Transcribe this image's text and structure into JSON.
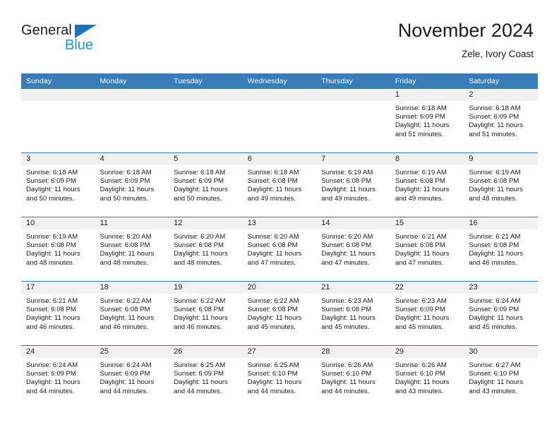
{
  "brand": {
    "name_top": "General",
    "name_bottom": "Blue",
    "triangle_color": "#1c75bc",
    "blue_color": "#1c9ad6"
  },
  "header": {
    "title": "November 2024",
    "location": "Zele, Ivory Coast"
  },
  "calendar": {
    "header_bg": "#3a7cb9",
    "daynum_bg": "#f1f1f1",
    "weekdays": [
      "Sunday",
      "Monday",
      "Tuesday",
      "Wednesday",
      "Thursday",
      "Friday",
      "Saturday"
    ],
    "weeks": [
      [
        {
          "day": "",
          "sunrise": "",
          "sunset": "",
          "daylight_line1": "",
          "daylight_line2": ""
        },
        {
          "day": "",
          "sunrise": "",
          "sunset": "",
          "daylight_line1": "",
          "daylight_line2": ""
        },
        {
          "day": "",
          "sunrise": "",
          "sunset": "",
          "daylight_line1": "",
          "daylight_line2": ""
        },
        {
          "day": "",
          "sunrise": "",
          "sunset": "",
          "daylight_line1": "",
          "daylight_line2": ""
        },
        {
          "day": "",
          "sunrise": "",
          "sunset": "",
          "daylight_line1": "",
          "daylight_line2": ""
        },
        {
          "day": "1",
          "sunrise": "Sunrise: 6:18 AM",
          "sunset": "Sunset: 6:09 PM",
          "daylight_line1": "Daylight: 11 hours",
          "daylight_line2": "and 51 minutes."
        },
        {
          "day": "2",
          "sunrise": "Sunrise: 6:18 AM",
          "sunset": "Sunset: 6:09 PM",
          "daylight_line1": "Daylight: 11 hours",
          "daylight_line2": "and 51 minutes."
        }
      ],
      [
        {
          "day": "3",
          "sunrise": "Sunrise: 6:18 AM",
          "sunset": "Sunset: 6:09 PM",
          "daylight_line1": "Daylight: 11 hours",
          "daylight_line2": "and 50 minutes."
        },
        {
          "day": "4",
          "sunrise": "Sunrise: 6:18 AM",
          "sunset": "Sunset: 6:09 PM",
          "daylight_line1": "Daylight: 11 hours",
          "daylight_line2": "and 50 minutes."
        },
        {
          "day": "5",
          "sunrise": "Sunrise: 6:18 AM",
          "sunset": "Sunset: 6:09 PM",
          "daylight_line1": "Daylight: 11 hours",
          "daylight_line2": "and 50 minutes."
        },
        {
          "day": "6",
          "sunrise": "Sunrise: 6:18 AM",
          "sunset": "Sunset: 6:08 PM",
          "daylight_line1": "Daylight: 11 hours",
          "daylight_line2": "and 49 minutes."
        },
        {
          "day": "7",
          "sunrise": "Sunrise: 6:19 AM",
          "sunset": "Sunset: 6:08 PM",
          "daylight_line1": "Daylight: 11 hours",
          "daylight_line2": "and 49 minutes."
        },
        {
          "day": "8",
          "sunrise": "Sunrise: 6:19 AM",
          "sunset": "Sunset: 6:08 PM",
          "daylight_line1": "Daylight: 11 hours",
          "daylight_line2": "and 49 minutes."
        },
        {
          "day": "9",
          "sunrise": "Sunrise: 6:19 AM",
          "sunset": "Sunset: 6:08 PM",
          "daylight_line1": "Daylight: 11 hours",
          "daylight_line2": "and 48 minutes."
        }
      ],
      [
        {
          "day": "10",
          "sunrise": "Sunrise: 6:19 AM",
          "sunset": "Sunset: 6:08 PM",
          "daylight_line1": "Daylight: 11 hours",
          "daylight_line2": "and 48 minutes."
        },
        {
          "day": "11",
          "sunrise": "Sunrise: 6:20 AM",
          "sunset": "Sunset: 6:08 PM",
          "daylight_line1": "Daylight: 11 hours",
          "daylight_line2": "and 48 minutes."
        },
        {
          "day": "12",
          "sunrise": "Sunrise: 6:20 AM",
          "sunset": "Sunset: 6:08 PM",
          "daylight_line1": "Daylight: 11 hours",
          "daylight_line2": "and 48 minutes."
        },
        {
          "day": "13",
          "sunrise": "Sunrise: 6:20 AM",
          "sunset": "Sunset: 6:08 PM",
          "daylight_line1": "Daylight: 11 hours",
          "daylight_line2": "and 47 minutes."
        },
        {
          "day": "14",
          "sunrise": "Sunrise: 6:20 AM",
          "sunset": "Sunset: 6:08 PM",
          "daylight_line1": "Daylight: 11 hours",
          "daylight_line2": "and 47 minutes."
        },
        {
          "day": "15",
          "sunrise": "Sunrise: 6:21 AM",
          "sunset": "Sunset: 6:08 PM",
          "daylight_line1": "Daylight: 11 hours",
          "daylight_line2": "and 47 minutes."
        },
        {
          "day": "16",
          "sunrise": "Sunrise: 6:21 AM",
          "sunset": "Sunset: 6:08 PM",
          "daylight_line1": "Daylight: 11 hours",
          "daylight_line2": "and 46 minutes."
        }
      ],
      [
        {
          "day": "17",
          "sunrise": "Sunrise: 6:21 AM",
          "sunset": "Sunset: 6:08 PM",
          "daylight_line1": "Daylight: 11 hours",
          "daylight_line2": "and 46 minutes."
        },
        {
          "day": "18",
          "sunrise": "Sunrise: 6:22 AM",
          "sunset": "Sunset: 6:08 PM",
          "daylight_line1": "Daylight: 11 hours",
          "daylight_line2": "and 46 minutes."
        },
        {
          "day": "19",
          "sunrise": "Sunrise: 6:22 AM",
          "sunset": "Sunset: 6:08 PM",
          "daylight_line1": "Daylight: 11 hours",
          "daylight_line2": "and 46 minutes."
        },
        {
          "day": "20",
          "sunrise": "Sunrise: 6:22 AM",
          "sunset": "Sunset: 6:08 PM",
          "daylight_line1": "Daylight: 11 hours",
          "daylight_line2": "and 45 minutes."
        },
        {
          "day": "21",
          "sunrise": "Sunrise: 6:23 AM",
          "sunset": "Sunset: 6:08 PM",
          "daylight_line1": "Daylight: 11 hours",
          "daylight_line2": "and 45 minutes."
        },
        {
          "day": "22",
          "sunrise": "Sunrise: 6:23 AM",
          "sunset": "Sunset: 6:09 PM",
          "daylight_line1": "Daylight: 11 hours",
          "daylight_line2": "and 45 minutes."
        },
        {
          "day": "23",
          "sunrise": "Sunrise: 6:24 AM",
          "sunset": "Sunset: 6:09 PM",
          "daylight_line1": "Daylight: 11 hours",
          "daylight_line2": "and 45 minutes."
        }
      ],
      [
        {
          "day": "24",
          "sunrise": "Sunrise: 6:24 AM",
          "sunset": "Sunset: 6:09 PM",
          "daylight_line1": "Daylight: 11 hours",
          "daylight_line2": "and 44 minutes."
        },
        {
          "day": "25",
          "sunrise": "Sunrise: 6:24 AM",
          "sunset": "Sunset: 6:09 PM",
          "daylight_line1": "Daylight: 11 hours",
          "daylight_line2": "and 44 minutes."
        },
        {
          "day": "26",
          "sunrise": "Sunrise: 6:25 AM",
          "sunset": "Sunset: 6:09 PM",
          "daylight_line1": "Daylight: 11 hours",
          "daylight_line2": "and 44 minutes."
        },
        {
          "day": "27",
          "sunrise": "Sunrise: 6:25 AM",
          "sunset": "Sunset: 6:10 PM",
          "daylight_line1": "Daylight: 11 hours",
          "daylight_line2": "and 44 minutes."
        },
        {
          "day": "28",
          "sunrise": "Sunrise: 6:26 AM",
          "sunset": "Sunset: 6:10 PM",
          "daylight_line1": "Daylight: 11 hours",
          "daylight_line2": "and 44 minutes."
        },
        {
          "day": "29",
          "sunrise": "Sunrise: 6:26 AM",
          "sunset": "Sunset: 6:10 PM",
          "daylight_line1": "Daylight: 11 hours",
          "daylight_line2": "and 43 minutes."
        },
        {
          "day": "30",
          "sunrise": "Sunrise: 6:27 AM",
          "sunset": "Sunset: 6:10 PM",
          "daylight_line1": "Daylight: 11 hours",
          "daylight_line2": "and 43 minutes."
        }
      ]
    ]
  }
}
